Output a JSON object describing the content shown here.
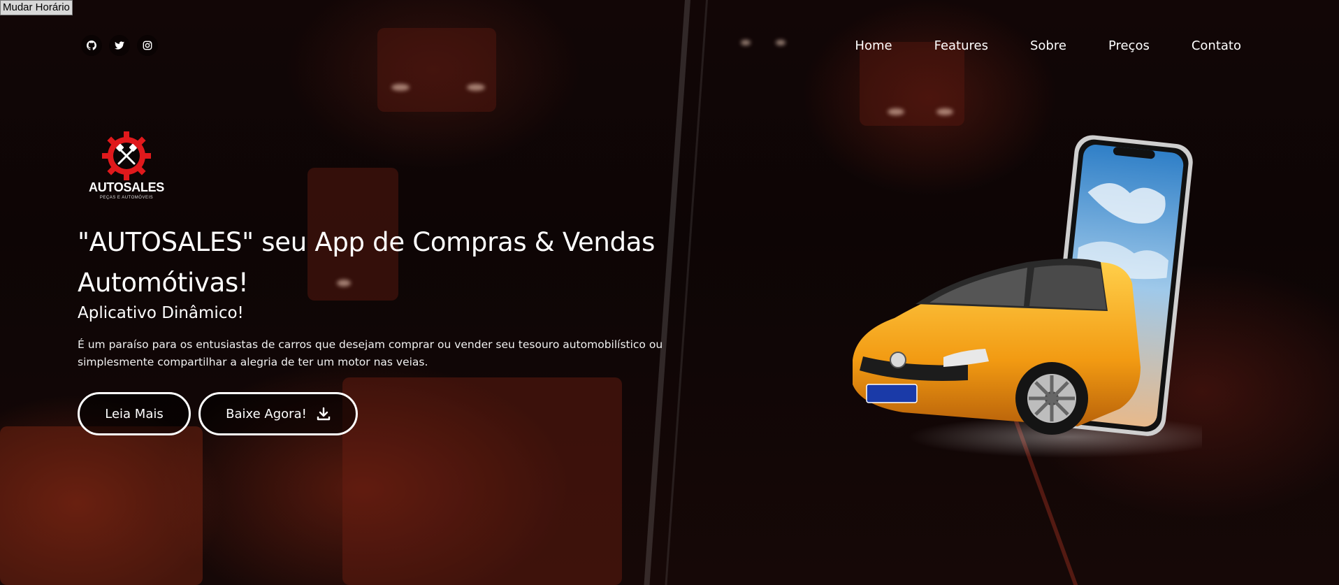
{
  "page": {
    "toggle_button": "Mudar Horário"
  },
  "header": {
    "social_icons": [
      "github-icon",
      "twitter-icon",
      "instagram-icon"
    ],
    "nav": [
      "Home",
      "Features",
      "Sobre",
      "Preços",
      "Contato"
    ]
  },
  "logo": {
    "brand": "AUTOSALES",
    "tagline": "PEÇAS E AUTOMÓVEIS"
  },
  "hero": {
    "headline": "\"AUTOSALES\" seu App de Compras & Vendas Automótivas!",
    "subheadline": "Aplicativo Dinâmico!",
    "description": "É um paraíso para os entusiastas de carros que desejam comprar ou vender seu tesouro automobilístico ou simplesmente compartilhar a alegria de ter um motor nas veias.",
    "read_more": "Leia Mais",
    "download": "Baixe Agora!"
  },
  "colors": {
    "accent_red": "#e0191c",
    "car_yellow": "#f2a21a",
    "text": "#ffffff"
  }
}
